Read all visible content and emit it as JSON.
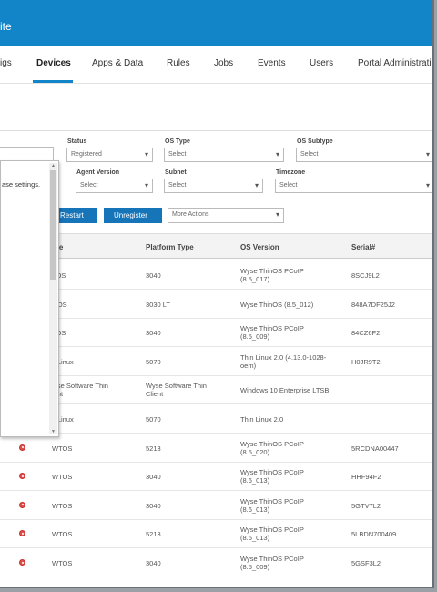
{
  "header": {
    "brand": "ite"
  },
  "nav": {
    "items": [
      "igs",
      "Devices",
      "Apps & Data",
      "Rules",
      "Jobs",
      "Events",
      "Users",
      "Portal Administration"
    ]
  },
  "filters": {
    "status_label": "Status",
    "status_value": "Registered",
    "os_type_label": "OS Type",
    "os_type_value": "Select",
    "os_subtype_label": "OS Subtype",
    "os_subtype_value": "Select",
    "agent_version_label": "Agent Version",
    "agent_version_value": "Select",
    "subnet_label": "Subnet",
    "subnet_value": "Select",
    "timezone_label": "Timezone",
    "timezone_value": "Select"
  },
  "actions": {
    "restart": "Restart",
    "unregister": "Unregister",
    "more_actions": "More Actions"
  },
  "popup": {
    "text": "ase settings."
  },
  "table": {
    "headers": [
      "pe",
      "Platform Type",
      "OS Version",
      "Serial#"
    ],
    "rows": [
      {
        "type": "TOS",
        "platform": "3040",
        "os": "Wyse ThinOS PCoIP\n(8.5_017)",
        "serial": "8SCJ9L2",
        "icon": false
      },
      {
        "type": "inOS",
        "platform": "3030 LT",
        "os": "Wyse ThinOS (8.5_012)",
        "serial": "848A7DF25J2",
        "icon": false
      },
      {
        "type": "TOS",
        "platform": "3040",
        "os": "Wyse ThinOS PCoIP\n(8.5_009)",
        "serial": "84CZ6F2",
        "icon": false
      },
      {
        "type": "inLinux",
        "platform": "5070",
        "os": "Thin Linux 2.0 (4.13.0-1028-\noem)",
        "serial": "H0JR9T2",
        "icon": false
      },
      {
        "type": "/yse Software Thin\nient",
        "platform": "Wyse Software Thin\nClient",
        "os": "Windows 10 Enterprise LTSB",
        "serial": "",
        "icon": false
      },
      {
        "type": "inLinux",
        "platform": "5070",
        "os": "Thin Linux 2.0",
        "serial": "",
        "icon": false
      },
      {
        "type": "WTOS",
        "platform": "5213",
        "os": "Wyse ThinOS PCoIP\n(8.5_020)",
        "serial": "5RCDNA00447",
        "icon": true
      },
      {
        "type": "WTOS",
        "platform": "3040",
        "os": "Wyse ThinOS PCoIP\n(8.6_013)",
        "serial": "HHF94F2",
        "icon": true
      },
      {
        "type": "WTOS",
        "platform": "3040",
        "os": "Wyse ThinOS PCoIP\n(8.6_013)",
        "serial": "5GTV7L2",
        "icon": true
      },
      {
        "type": "WTOS",
        "platform": "5213",
        "os": "Wyse ThinOS PCoIP\n(8.6_013)",
        "serial": "5LBDN700409",
        "icon": true
      },
      {
        "type": "WTOS",
        "platform": "3040",
        "os": "Wyse ThinOS PCoIP\n(8.5_009)",
        "serial": "5GSF3L2",
        "icon": true
      }
    ]
  }
}
